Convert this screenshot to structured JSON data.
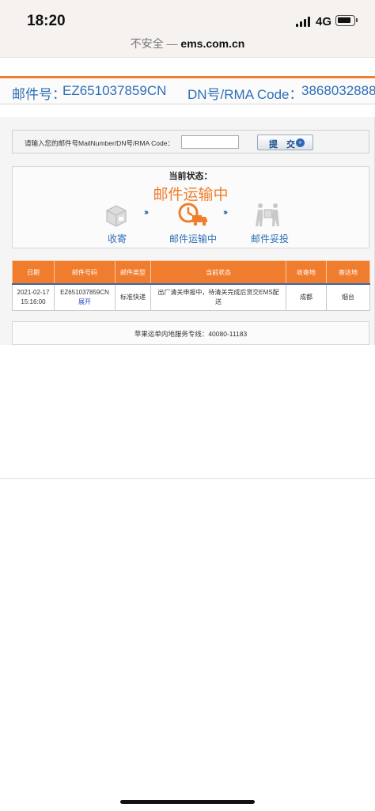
{
  "status_bar": {
    "time": "18:20",
    "network": "4G"
  },
  "browser": {
    "security_label": "不安全 —",
    "domain": "ems.com.cn"
  },
  "tracking_header": {
    "mail_no_label": "邮件号：",
    "mail_no_value": "EZ651037859CN",
    "dn_label": "DN号/RMA Code：",
    "dn_value": "3868032888"
  },
  "search": {
    "label": "请输入您的邮件号MailNumber/DN号/RMA Code：",
    "value": "",
    "submit_label": "提 交"
  },
  "status_panel": {
    "current_label": "当前状态：",
    "current_status": "邮件运输中",
    "steps": [
      "收寄",
      "邮件运输中",
      "邮件妥投"
    ]
  },
  "table": {
    "headers": [
      "日期",
      "邮件号码",
      "邮件类型",
      "当前状态",
      "收寄地",
      "寄达地"
    ],
    "rows": [
      {
        "date": "2021-02-17",
        "time": "15:16:00",
        "mail_no": "EZ651037859CN",
        "expand": "展开",
        "type": "标准快递",
        "status": "出厂清关申报中，待清关完成后货交EMS配送",
        "origin": "成都",
        "destination": "烟台"
      }
    ]
  },
  "service": {
    "text": "苹果运单内地服务专线：40080-11183"
  },
  "colors": {
    "accent": "#f07c2e",
    "link": "#2f6fb6",
    "status_orange": "#ef7d2b"
  }
}
